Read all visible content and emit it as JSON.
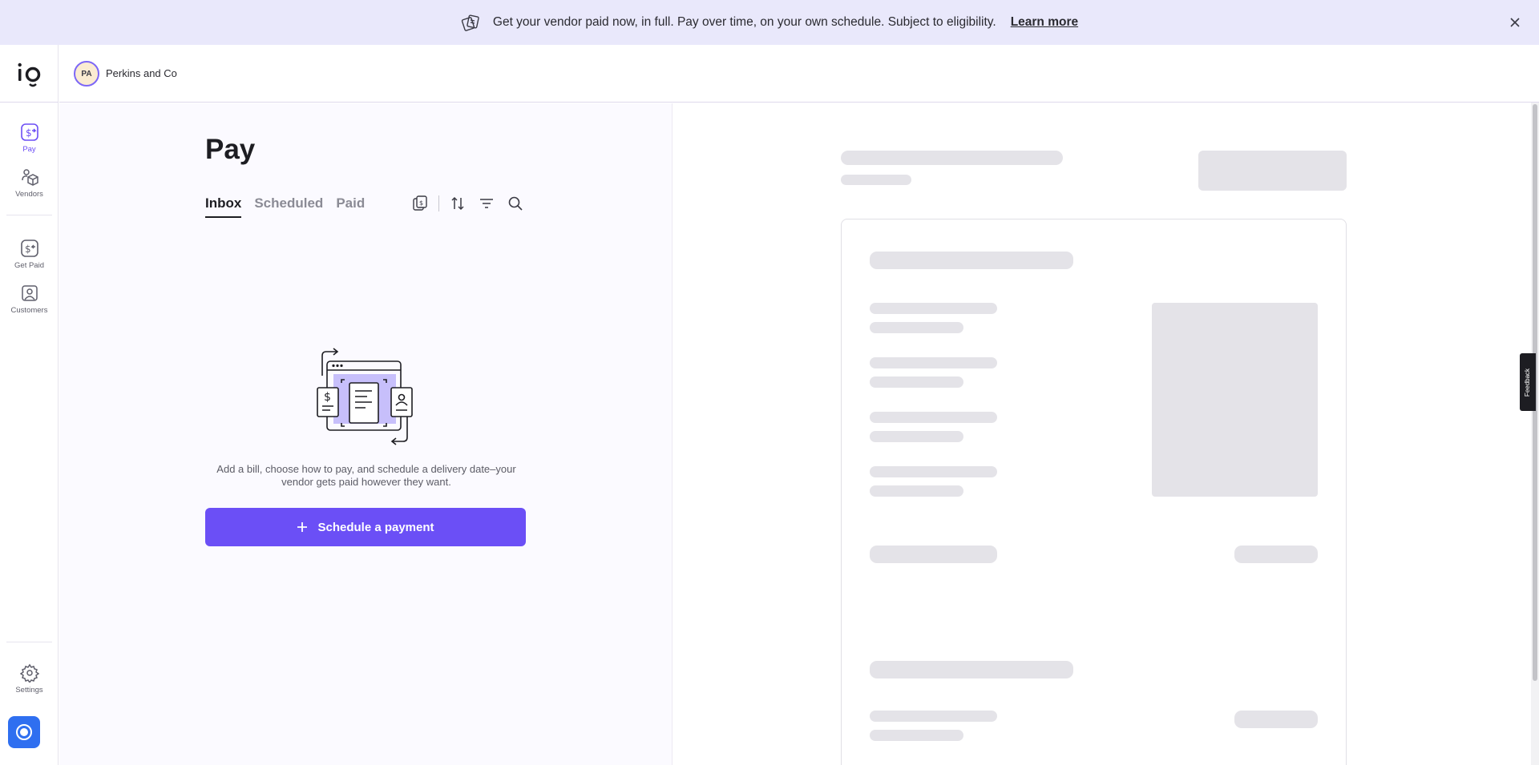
{
  "banner": {
    "icon": "payment-cards-icon",
    "message": "Get your vendor paid now, in full. Pay over time, on your own schedule. Subject to eligibility.",
    "link_label": "Learn more",
    "close_icon": "close-icon"
  },
  "brand": {
    "logo_text": "io"
  },
  "sidebar": {
    "items": [
      {
        "label": "Pay",
        "icon": "pay-icon",
        "active": true
      },
      {
        "label": "Vendors",
        "icon": "vendors-icon",
        "active": false
      },
      {
        "label": "Get Paid",
        "icon": "get-paid-icon",
        "active": false
      },
      {
        "label": "Customers",
        "icon": "customers-icon",
        "active": false
      }
    ],
    "settings_label": "Settings"
  },
  "header": {
    "company_initials": "PA",
    "company_name": "Perkins and Co"
  },
  "main": {
    "title": "Pay",
    "tabs": [
      {
        "label": "Inbox",
        "active": true
      },
      {
        "label": "Scheduled",
        "active": false
      },
      {
        "label": "Paid",
        "active": false
      }
    ],
    "tools": [
      "bills-icon",
      "sort-icon",
      "filter-icon",
      "search-icon"
    ],
    "empty_state": {
      "text": "Add a bill, choose how to pay, and schedule a delivery date–your vendor gets paid however they want.",
      "button_label": "Schedule a payment"
    }
  },
  "feedback_label": "Feedback",
  "colors": {
    "accent": "#6b4ff6",
    "banner_bg": "#e9e8fb",
    "panel_bg": "#fbfaff",
    "skeleton": "#e4e3e8",
    "help_button": "#2f6ff0"
  }
}
